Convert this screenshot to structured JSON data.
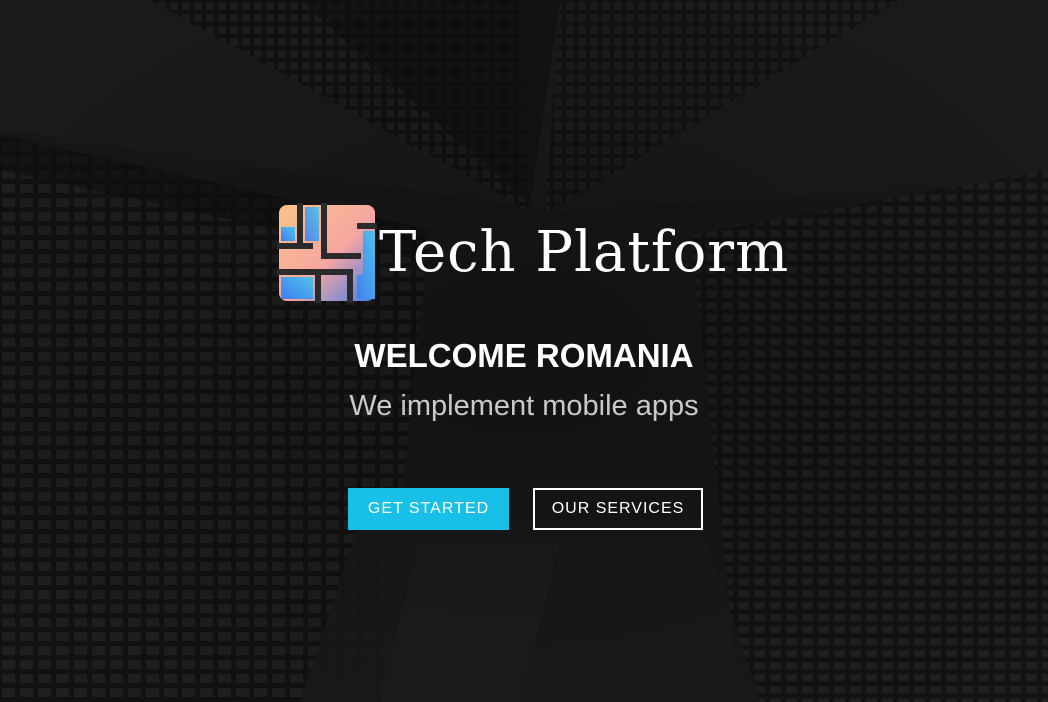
{
  "brand": {
    "name": "Tech Platform",
    "logo_icon": "tech-platform-logo-icon",
    "logo_colors": [
      "#f9c38a",
      "#f7a6a0",
      "#4fc3e8",
      "#3f7ef0"
    ]
  },
  "hero": {
    "headline": "WELCOME ROMANIA",
    "subline": "We implement mobile apps",
    "background": "grayscale-skyscrapers-photo"
  },
  "buttons": {
    "get_started": "GET STARTED",
    "our_services": "OUR SERVICES"
  },
  "colors": {
    "accent": "#18bfe6",
    "text": "#ffffff",
    "subtext": "#c9c9c9",
    "background": "#2a2a2a"
  }
}
